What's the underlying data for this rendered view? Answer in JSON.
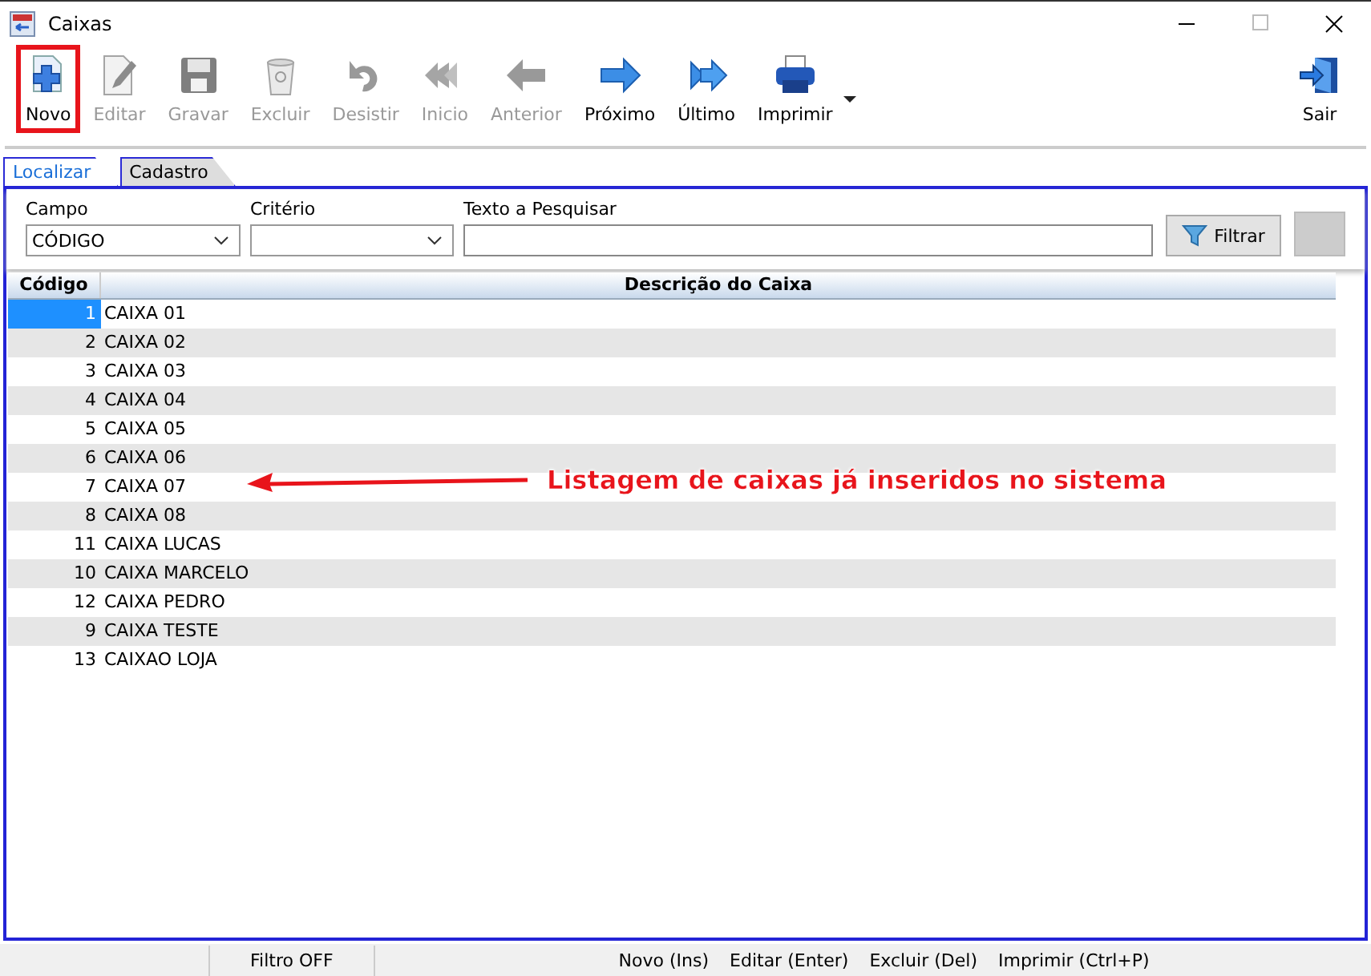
{
  "window": {
    "title": "Caixas"
  },
  "toolbar": [
    {
      "label": "Novo",
      "kind": "new",
      "disabled": false,
      "highlighted": true
    },
    {
      "label": "Editar",
      "kind": "edit",
      "disabled": true,
      "highlighted": false
    },
    {
      "label": "Gravar",
      "kind": "save",
      "disabled": true,
      "highlighted": false
    },
    {
      "label": "Excluir",
      "kind": "trash",
      "disabled": true,
      "highlighted": false
    },
    {
      "label": "Desistir",
      "kind": "undo",
      "disabled": true,
      "highlighted": false
    },
    {
      "label": "Inicio",
      "kind": "first",
      "disabled": true,
      "highlighted": false
    },
    {
      "label": "Anterior",
      "kind": "prev",
      "disabled": true,
      "highlighted": false
    },
    {
      "label": "Próximo",
      "kind": "next",
      "disabled": false,
      "highlighted": false
    },
    {
      "label": "Último",
      "kind": "last",
      "disabled": false,
      "highlighted": false
    },
    {
      "label": "Imprimir",
      "kind": "print",
      "disabled": false,
      "highlighted": false
    },
    {
      "label": "Sair",
      "kind": "exit",
      "disabled": false,
      "highlighted": false
    }
  ],
  "tabs": [
    {
      "label": "Localizar",
      "selected": true
    },
    {
      "label": "Cadastro",
      "selected": false
    }
  ],
  "filter": {
    "campo_label": "Campo",
    "campo_value": "CÓDIGO",
    "criterio_label": "Critério",
    "texto_label": "Texto a Pesquisar",
    "filter_button": "Filtrar"
  },
  "table": {
    "columns": [
      "Código",
      "Descrição do Caixa"
    ],
    "rows": [
      {
        "code": "1",
        "description": "CAIXA 01",
        "selected": true
      },
      {
        "code": "2",
        "description": "CAIXA 02",
        "selected": false
      },
      {
        "code": "3",
        "description": "CAIXA 03",
        "selected": false
      },
      {
        "code": "4",
        "description": "CAIXA 04",
        "selected": false
      },
      {
        "code": "5",
        "description": "CAIXA 05",
        "selected": false
      },
      {
        "code": "6",
        "description": "CAIXA 06",
        "selected": false
      },
      {
        "code": "7",
        "description": "CAIXA 07",
        "selected": false
      },
      {
        "code": "8",
        "description": "CAIXA 08",
        "selected": false
      },
      {
        "code": "11",
        "description": "CAIXA LUCAS",
        "selected": false
      },
      {
        "code": "10",
        "description": "CAIXA MARCELO",
        "selected": false
      },
      {
        "code": "12",
        "description": "CAIXA PEDRO",
        "selected": false
      },
      {
        "code": "9",
        "description": "CAIXA TESTE",
        "selected": false
      },
      {
        "code": "13",
        "description": "CAIXAO LOJA",
        "selected": false
      }
    ]
  },
  "annotation": {
    "text": "Listagem de caixas já inseridos no sistema"
  },
  "status_bar": [
    "Filtro OFF",
    "Novo (Ins)",
    "Editar (Enter)",
    "Excluir (Del)",
    "Imprimir (Ctrl+P)"
  ]
}
